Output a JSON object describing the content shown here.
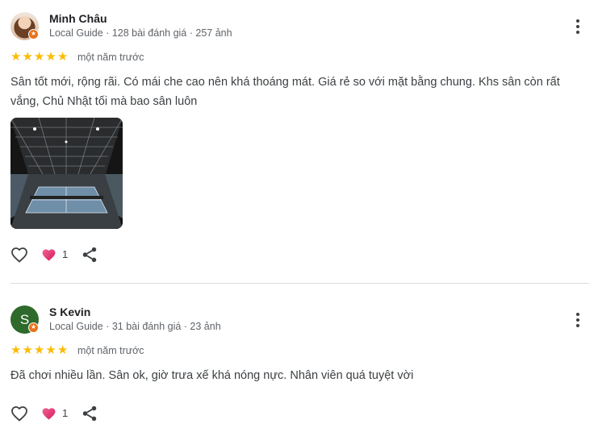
{
  "reviews": [
    {
      "name": "Minh Châu",
      "meta": "Local Guide · 128 bài đánh giá · 257 ảnh",
      "avatar_letter": "",
      "rating": 5,
      "time": "một năm trước",
      "text": "Sân tốt mới, rộng rãi. Có mái che cao nên khá thoáng mát. Giá rẻ so với mặt bằng chung. Khs sân còn rất vắng, Chủ Nhật tối mà bao sân luôn",
      "likes": "1"
    },
    {
      "name": "S Kevin",
      "meta": "Local Guide · 31 bài đánh giá · 23 ảnh",
      "avatar_letter": "S",
      "rating": 5,
      "time": "một năm trước",
      "text": "Đã chơi nhiều lần. Sân ok, giờ trưa xế khá nóng nực. Nhân viên quá tuyệt vời",
      "likes": "1"
    }
  ],
  "icons": {
    "star": "star-icon",
    "more": "more-vert-icon",
    "like": "heart-outline-icon",
    "reaction": "heart-filled-icon",
    "share": "share-icon",
    "badge": "local-guide-badge-icon"
  },
  "colors": {
    "star": "#fbbc04",
    "reaction_heart": "#e8336b",
    "badge": "#e8711a",
    "avatar_s": "#2d6a2b"
  }
}
